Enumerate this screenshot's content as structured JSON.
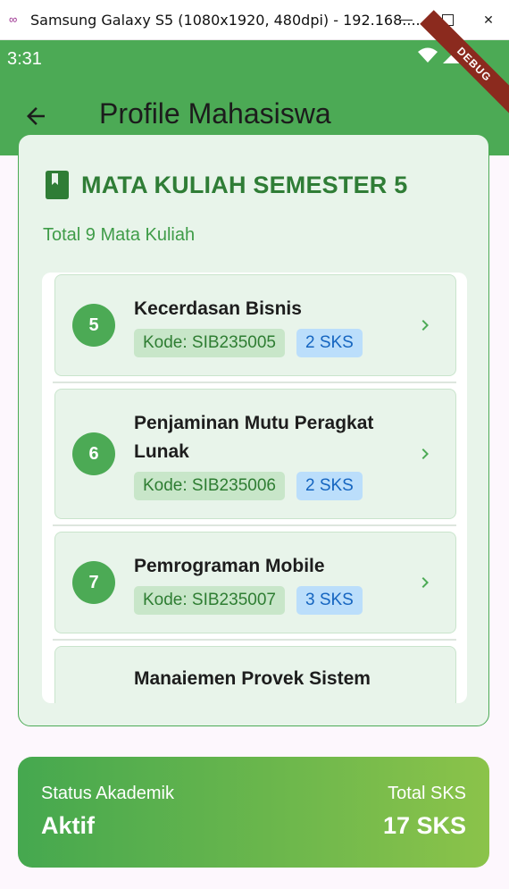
{
  "window": {
    "title": "Samsung Galaxy S5 (1080x1920, 480dpi) - 192.168....",
    "minimize": "",
    "close": "✕"
  },
  "status_bar": {
    "time": "3:31",
    "debug_label": "DEBUG"
  },
  "appbar": {
    "title": "Profile Mahasiswa"
  },
  "courses": {
    "header": "MATA KULIAH SEMESTER 5",
    "subtitle": "Total 9 Mata Kuliah",
    "items": [
      {
        "number": "5",
        "name": "Kecerdasan Bisnis",
        "kode": "Kode: SIB235005",
        "sks": "2 SKS"
      },
      {
        "number": "6",
        "name": "Penjaminan Mutu Peragkat Lunak",
        "kode": "Kode: SIB235006",
        "sks": "2 SKS"
      },
      {
        "number": "7",
        "name": "Pemrograman Mobile",
        "kode": "Kode: SIB235007",
        "sks": "3 SKS"
      },
      {
        "number": "",
        "name": "Manaiemen Provek Sistem",
        "kode": "",
        "sks": ""
      }
    ]
  },
  "summary": {
    "status_label": "Status Akademik",
    "status_value": "Aktif",
    "sks_label": "Total SKS",
    "sks_value": "17 SKS"
  },
  "colors": {
    "primary": "#4caa55",
    "primary_dark": "#2f7d36",
    "card_bg": "#e8f4ea",
    "kode_bg": "#c8e6c9",
    "sks_bg": "#bbdefb"
  },
  "icons": [
    "flutter-logo-icon",
    "minimize-icon",
    "maximize-icon",
    "close-icon",
    "wifi-icon",
    "signal-icon",
    "battery-icon",
    "back-arrow-icon",
    "book-icon",
    "chevron-right-icon"
  ]
}
